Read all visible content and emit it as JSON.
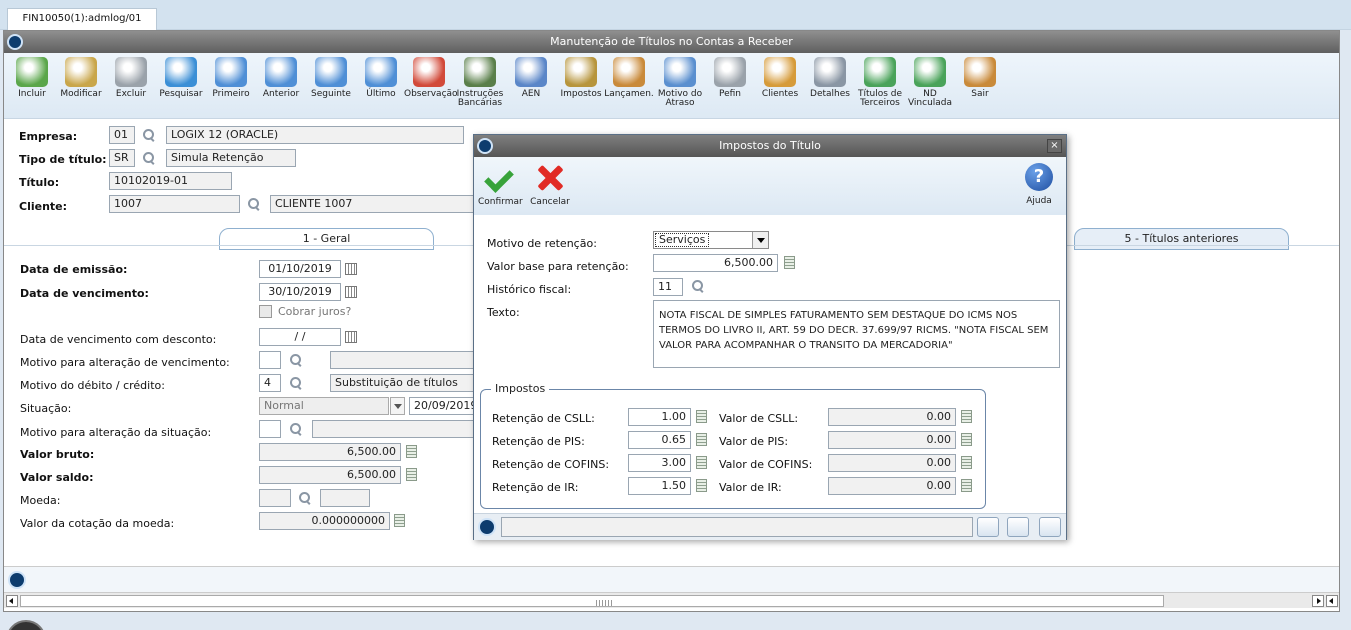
{
  "outer_tab": "FIN10050(1):admlog/01",
  "window_title": "Manutenção de Títulos no Contas a Receber",
  "toolbar": [
    {
      "label": "Incluir",
      "icon": "add-icon",
      "color": "#5aa64a"
    },
    {
      "label": "Modificar",
      "icon": "edit-icon",
      "color": "#c9a64a"
    },
    {
      "label": "Excluir",
      "icon": "trash-icon",
      "color": "#9aa2aa"
    },
    {
      "label": "Pesquisar",
      "icon": "search-icon",
      "color": "#3b8fd6"
    },
    {
      "label": "Primeiro",
      "icon": "first-arrow-icon",
      "color": "#4f8fd6"
    },
    {
      "label": "Anterior",
      "icon": "previous-arrow-icon",
      "color": "#4f8fd6"
    },
    {
      "label": "Seguinte",
      "icon": "next-arrow-icon",
      "color": "#4f8fd6"
    },
    {
      "label": "Último",
      "icon": "last-arrow-icon",
      "color": "#4f8fd6"
    },
    {
      "label": "Observação",
      "icon": "notepad-icon",
      "color": "#d24a3a"
    },
    {
      "label": "Instruções Bancárias",
      "icon": "bank-icon",
      "color": "#5a7f4a"
    },
    {
      "label": "AEN",
      "icon": "document-edit-icon",
      "color": "#5a86c8"
    },
    {
      "label": "Impostos",
      "icon": "scales-icon",
      "color": "#b7953c"
    },
    {
      "label": "Lançamen.",
      "icon": "book-icon",
      "color": "#c98a3a"
    },
    {
      "label": "Motivo do Atraso",
      "icon": "calendar-icon",
      "color": "#5a8fcf"
    },
    {
      "label": "Pefin",
      "icon": "clipboard-icon",
      "color": "#9aa2aa"
    },
    {
      "label": "Clientes",
      "icon": "users-icon",
      "color": "#d69b3a"
    },
    {
      "label": "Detalhes",
      "icon": "magnifier-list-icon",
      "color": "#8a96a4"
    },
    {
      "label": "Títulos de Terceiros",
      "icon": "money-document-icon",
      "color": "#4aa35a"
    },
    {
      "label": "ND Vinculada",
      "icon": "document-add-icon",
      "color": "#4aa35a"
    },
    {
      "label": "Sair",
      "icon": "exit-door-icon",
      "color": "#c98a3a"
    }
  ],
  "header": {
    "empresa": {
      "label": "Empresa:",
      "code": "01",
      "name": "LOGIX 12 (ORACLE)"
    },
    "tipo": {
      "label": "Tipo de título:",
      "code": "SR",
      "name": "Simula Retenção"
    },
    "titulo": {
      "label": "Título:",
      "value": "10102019-01"
    },
    "cliente": {
      "label": "Cliente:",
      "code": "1007",
      "name": "CLIENTE 1007"
    }
  },
  "tabs": {
    "geral": "1 - Geral",
    "anteriores": "5 - Títulos anteriores"
  },
  "form": {
    "emissao": {
      "label": "Data de emissão:",
      "value": "01/10/2019"
    },
    "vencimento": {
      "label": "Data de vencimento:",
      "value": "30/10/2019"
    },
    "cobrar_juros": "Cobrar juros?",
    "venc_desconto": {
      "label": "Data de vencimento com desconto:",
      "value": " / /"
    },
    "motivo_venc": {
      "label": "Motivo para alteração de vencimento:"
    },
    "motivo_debito": {
      "label": "Motivo do débito / crédito:",
      "code": "4",
      "name": "Substituição de títulos"
    },
    "situacao": {
      "label": "Situação:",
      "value": "Normal",
      "date": "20/09/2019"
    },
    "motivo_situacao": {
      "label": "Motivo para alteração da situação:"
    },
    "valor_bruto": {
      "label": "Valor bruto:",
      "value": "6,500.00"
    },
    "valor_saldo": {
      "label": "Valor saldo:",
      "value": "6,500.00"
    },
    "moeda": {
      "label": "Moeda:"
    },
    "cotacao": {
      "label": "Valor da cotação da moeda:",
      "value": "0.000000000"
    }
  },
  "dialog": {
    "title": "Impostos do Título",
    "close": "×",
    "confirm": "Confirmar",
    "cancel": "Cancelar",
    "help": "Ajuda",
    "help_glyph": "?",
    "motivo": {
      "label": "Motivo de retenção:",
      "value": "Serviços"
    },
    "base": {
      "label": "Valor base para retenção:",
      "value": "6,500.00"
    },
    "historico": {
      "label": "Histórico fiscal:",
      "value": "11"
    },
    "texto": {
      "label": "Texto:",
      "value": "NOTA FISCAL DE SIMPLES FATURAMENTO SEM DESTAQUE DO ICMS NOS TERMOS DO LIVRO II, ART. 59 DO DECR. 37.699/97 RICMS. \"NOTA FISCAL SEM VALOR PARA ACOMPANHAR O TRANSITO DA MERCADORIA\""
    },
    "impostos": {
      "title": "Impostos",
      "rows": [
        {
          "ret_label": "Retenção de CSLL:",
          "ret": "1.00",
          "val_label": "Valor de CSLL:",
          "val": "0.00"
        },
        {
          "ret_label": "Retenção de PIS:",
          "ret": "0.65",
          "val_label": "Valor de PIS:",
          "val": "0.00"
        },
        {
          "ret_label": "Retenção de COFINS:",
          "ret": "3.00",
          "val_label": "Valor de COFINS:",
          "val": "0.00"
        },
        {
          "ret_label": "Retenção de IR:",
          "ret": "1.50",
          "val_label": "Valor de IR:",
          "val": "0.00"
        }
      ]
    }
  }
}
